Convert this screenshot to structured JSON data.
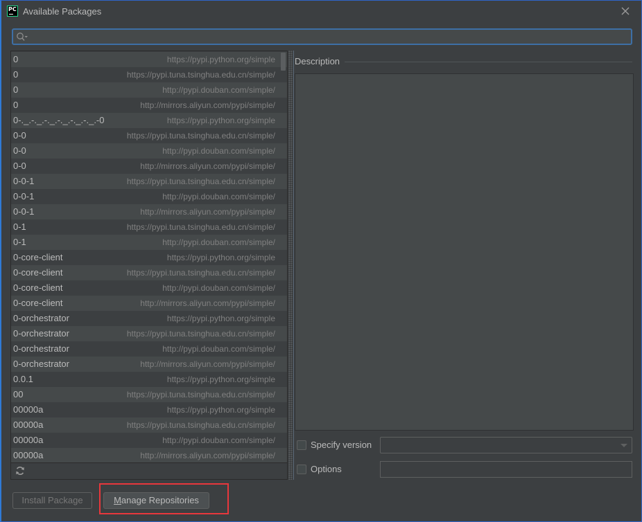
{
  "window": {
    "title": "Available Packages",
    "app_icon_text": "PC"
  },
  "search": {
    "value": "",
    "placeholder": ""
  },
  "packages": [
    {
      "name": "0",
      "repo": "https://pypi.python.org/simple"
    },
    {
      "name": "0",
      "repo": "https://pypi.tuna.tsinghua.edu.cn/simple/"
    },
    {
      "name": "0",
      "repo": "http://pypi.douban.com/simple/"
    },
    {
      "name": "0",
      "repo": "http://mirrors.aliyun.com/pypi/simple/"
    },
    {
      "name": "0-._.-._.-._.-._.-._.-._.-0",
      "repo": "https://pypi.python.org/simple"
    },
    {
      "name": "0-0",
      "repo": "https://pypi.tuna.tsinghua.edu.cn/simple/"
    },
    {
      "name": "0-0",
      "repo": "http://pypi.douban.com/simple/"
    },
    {
      "name": "0-0",
      "repo": "http://mirrors.aliyun.com/pypi/simple/"
    },
    {
      "name": "0-0-1",
      "repo": "https://pypi.tuna.tsinghua.edu.cn/simple/"
    },
    {
      "name": "0-0-1",
      "repo": "http://pypi.douban.com/simple/"
    },
    {
      "name": "0-0-1",
      "repo": "http://mirrors.aliyun.com/pypi/simple/"
    },
    {
      "name": "0-1",
      "repo": "https://pypi.tuna.tsinghua.edu.cn/simple/"
    },
    {
      "name": "0-1",
      "repo": "http://pypi.douban.com/simple/"
    },
    {
      "name": "0-core-client",
      "repo": "https://pypi.python.org/simple"
    },
    {
      "name": "0-core-client",
      "repo": "https://pypi.tuna.tsinghua.edu.cn/simple/"
    },
    {
      "name": "0-core-client",
      "repo": "http://pypi.douban.com/simple/"
    },
    {
      "name": "0-core-client",
      "repo": "http://mirrors.aliyun.com/pypi/simple/"
    },
    {
      "name": "0-orchestrator",
      "repo": "https://pypi.python.org/simple"
    },
    {
      "name": "0-orchestrator",
      "repo": "https://pypi.tuna.tsinghua.edu.cn/simple/"
    },
    {
      "name": "0-orchestrator",
      "repo": "http://pypi.douban.com/simple/"
    },
    {
      "name": "0-orchestrator",
      "repo": "http://mirrors.aliyun.com/pypi/simple/"
    },
    {
      "name": "0.0.1",
      "repo": "https://pypi.python.org/simple"
    },
    {
      "name": "00",
      "repo": "https://pypi.tuna.tsinghua.edu.cn/simple/"
    },
    {
      "name": "00000a",
      "repo": "https://pypi.python.org/simple"
    },
    {
      "name": "00000a",
      "repo": "https://pypi.tuna.tsinghua.edu.cn/simple/"
    },
    {
      "name": "00000a",
      "repo": "http://pypi.douban.com/simple/"
    },
    {
      "name": "00000a",
      "repo": "http://mirrors.aliyun.com/pypi/simple/"
    }
  ],
  "description": {
    "title": "Description",
    "text": ""
  },
  "options": {
    "specify_version_label": "Specify version",
    "specify_version_checked": false,
    "version_value": "",
    "options_label": "Options",
    "options_checked": false,
    "options_value": ""
  },
  "buttons": {
    "install_label": "Install Package",
    "manage_mnemonic": "M",
    "manage_rest": "anage Repositories"
  },
  "colors": {
    "accent": "#3d6fa6",
    "highlight": "#e8373c",
    "background": "#3c3f41"
  }
}
